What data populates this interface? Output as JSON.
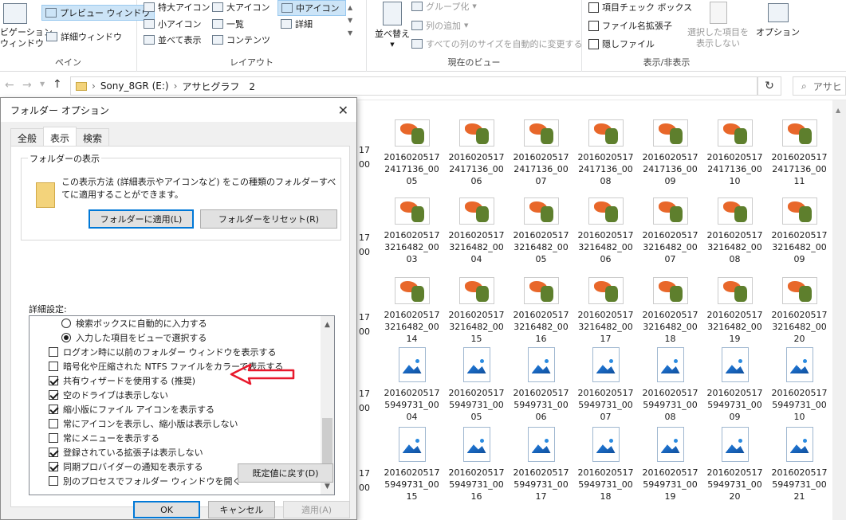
{
  "ribbon": {
    "pane": {
      "nav_pane_label": "ビゲーション\nウィンドウ",
      "preview_pane": "プレビュー ウィンドウ",
      "details_pane": "詳細ウィンドウ",
      "group_label": "ペイン"
    },
    "layout": {
      "items": [
        "特大アイコン",
        "大アイコン",
        "中アイコン",
        "小アイコン",
        "一覧",
        "詳細",
        "並べて表示",
        "コンテンツ"
      ],
      "selected": "中アイコン",
      "group_label": "レイアウト"
    },
    "current_view": {
      "sort_label": "並べ替え",
      "group_by": "グループ化",
      "add_column": "列の追加",
      "fit_columns": "すべての列のサイズを自動的に変更する",
      "group_label": "現在のビュー"
    },
    "show_hide": {
      "item_checkboxes": "項目チェック ボックス",
      "file_extensions": "ファイル名拡張子",
      "hidden_items": "隠しファイル",
      "hide_selected": "選択した項目を\n表示しない",
      "options": "オプション",
      "group_label": "表示/非表示"
    }
  },
  "address": {
    "segments": [
      "Sony_8GR (E:)",
      "アサヒグラフ　2"
    ],
    "search_placeholder": "アサヒ"
  },
  "files": {
    "row1": [
      {
        "l1": "2016020517",
        "l2": "2417136_00",
        "l3": "05"
      },
      {
        "l1": "2016020517",
        "l2": "2417136_00",
        "l3": "06"
      },
      {
        "l1": "2016020517",
        "l2": "2417136_00",
        "l3": "07"
      },
      {
        "l1": "2016020517",
        "l2": "2417136_00",
        "l3": "08"
      },
      {
        "l1": "2016020517",
        "l2": "2417136_00",
        "l3": "09"
      },
      {
        "l1": "2016020517",
        "l2": "2417136_00",
        "l3": "10"
      },
      {
        "l1": "2016020517",
        "l2": "2417136_00",
        "l3": "11"
      }
    ],
    "row2": [
      {
        "l1": "2016020517",
        "l2": "3216482_00",
        "l3": "03"
      },
      {
        "l1": "2016020517",
        "l2": "3216482_00",
        "l3": "04"
      },
      {
        "l1": "2016020517",
        "l2": "3216482_00",
        "l3": "05"
      },
      {
        "l1": "2016020517",
        "l2": "3216482_00",
        "l3": "06"
      },
      {
        "l1": "2016020517",
        "l2": "3216482_00",
        "l3": "07"
      },
      {
        "l1": "2016020517",
        "l2": "3216482_00",
        "l3": "08"
      },
      {
        "l1": "2016020517",
        "l2": "3216482_00",
        "l3": "09"
      }
    ],
    "row3": [
      {
        "l1": "2016020517",
        "l2": "3216482_00",
        "l3": "14"
      },
      {
        "l1": "2016020517",
        "l2": "3216482_00",
        "l3": "15"
      },
      {
        "l1": "2016020517",
        "l2": "3216482_00",
        "l3": "16"
      },
      {
        "l1": "2016020517",
        "l2": "3216482_00",
        "l3": "17"
      },
      {
        "l1": "2016020517",
        "l2": "3216482_00",
        "l3": "18"
      },
      {
        "l1": "2016020517",
        "l2": "3216482_00",
        "l3": "19"
      },
      {
        "l1": "2016020517",
        "l2": "3216482_00",
        "l3": "20"
      }
    ],
    "row4": [
      {
        "l1": "2016020517",
        "l2": "5949731_00",
        "l3": "04"
      },
      {
        "l1": "2016020517",
        "l2": "5949731_00",
        "l3": "05"
      },
      {
        "l1": "2016020517",
        "l2": "5949731_00",
        "l3": "06"
      },
      {
        "l1": "2016020517",
        "l2": "5949731_00",
        "l3": "07"
      },
      {
        "l1": "2016020517",
        "l2": "5949731_00",
        "l3": "08"
      },
      {
        "l1": "2016020517",
        "l2": "5949731_00",
        "l3": "09"
      },
      {
        "l1": "2016020517",
        "l2": "5949731_00",
        "l3": "10"
      }
    ],
    "row5": [
      {
        "l1": "2016020517",
        "l2": "5949731_00",
        "l3": "15"
      },
      {
        "l1": "2016020517",
        "l2": "5949731_00",
        "l3": "16"
      },
      {
        "l1": "2016020517",
        "l2": "5949731_00",
        "l3": "17"
      },
      {
        "l1": "2016020517",
        "l2": "5949731_00",
        "l3": "18"
      },
      {
        "l1": "2016020517",
        "l2": "5949731_00",
        "l3": "19"
      },
      {
        "l1": "2016020517",
        "l2": "5949731_00",
        "l3": "20"
      },
      {
        "l1": "2016020517",
        "l2": "5949731_00",
        "l3": "21"
      }
    ],
    "partial_left": [
      "17",
      "00",
      "17",
      "00",
      "17",
      "00",
      "17",
      "00",
      "17",
      "00"
    ]
  },
  "dialog": {
    "title": "フォルダー オプション",
    "tabs": [
      "全般",
      "表示",
      "検索"
    ],
    "active_tab": "表示",
    "folder_views": {
      "legend": "フォルダーの表示",
      "description": "この表示方法 (詳細表示やアイコンなど) をこの種類のフォルダーすべてに適用することができます。",
      "apply_button": "フォルダーに適用(L)",
      "reset_button": "フォルダーをリセット(R)"
    },
    "advanced_label": "詳細設定:",
    "advanced_items": [
      {
        "type": "radio",
        "label": "検索ボックスに自動的に入力する",
        "checked": false
      },
      {
        "type": "radio",
        "label": "入力した項目をビューで選択する",
        "checked": true
      },
      {
        "type": "check",
        "label": "ログオン時に以前のフォルダー ウィンドウを表示する",
        "checked": false
      },
      {
        "type": "check",
        "label": "暗号化や圧縮された NTFS ファイルをカラーで表示する",
        "checked": false
      },
      {
        "type": "check",
        "label": "共有ウィザードを使用する (推奨)",
        "checked": true
      },
      {
        "type": "check",
        "label": "空のドライブは表示しない",
        "checked": true
      },
      {
        "type": "check",
        "label": "縮小版にファイル アイコンを表示する",
        "checked": true
      },
      {
        "type": "check",
        "label": "常にアイコンを表示し、縮小版は表示しない",
        "checked": false
      },
      {
        "type": "check",
        "label": "常にメニューを表示する",
        "checked": false
      },
      {
        "type": "check",
        "label": "登録されている拡張子は表示しない",
        "checked": true
      },
      {
        "type": "check",
        "label": "同期プロバイダーの通知を表示する",
        "checked": true
      },
      {
        "type": "check",
        "label": "別のプロセスでフォルダー ウィンドウを開く",
        "checked": false
      }
    ],
    "restore_defaults": "既定値に戻す(D)",
    "ok": "OK",
    "cancel": "キャンセル",
    "apply": "適用(A)"
  },
  "colors": {
    "accent": "#0078d7",
    "annotation_arrow": "#e8192c"
  }
}
